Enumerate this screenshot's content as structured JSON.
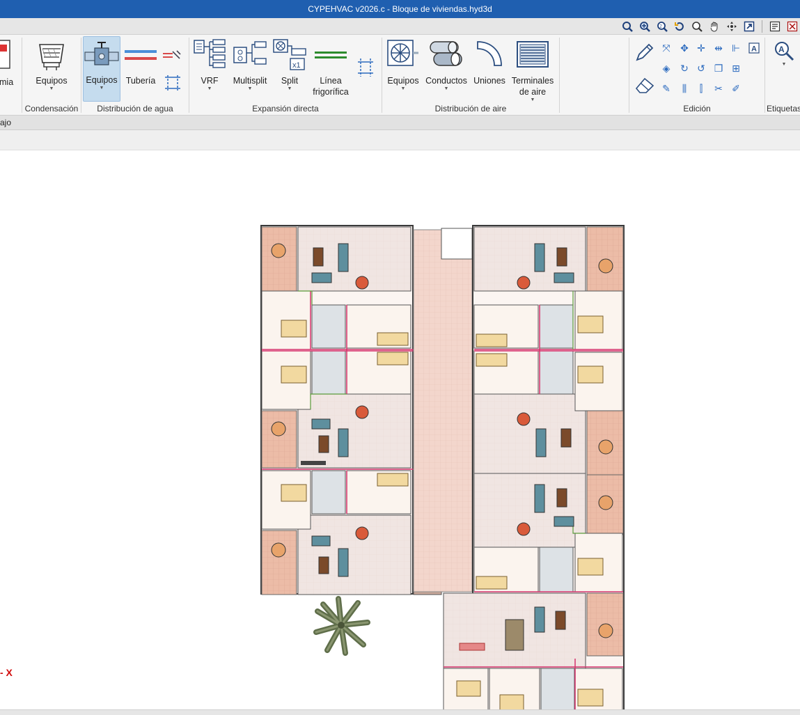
{
  "window": {
    "title": "CYPEHVAC v2026.c - Bloque de viviendas.hyd3d"
  },
  "quick_toolbar": {
    "icons": [
      "zoom-window-icon",
      "zoom-extents-icon",
      "zoom-previous-icon",
      "redraw-icon",
      "zoom-icon",
      "pan-hand-icon",
      "orbit-icon",
      "export-view-icon",
      "dxf-icon",
      "settings-icon"
    ]
  },
  "ribbon": {
    "partial_left_label": "rmia",
    "groups": {
      "condensacion": {
        "label": "Condensación",
        "equipos": "Equipos"
      },
      "distribucion_agua": {
        "label": "Distribución de agua",
        "equipos": "Equipos",
        "tuberia": "Tubería"
      },
      "expansion_directa": {
        "label": "Expansión directa",
        "vrf": "VRF",
        "multisplit": "Multisplit",
        "split": "Split",
        "linea_frigorifica": "Línea\nfrigorífica"
      },
      "distribucion_aire": {
        "label": "Distribución de aire",
        "equipos": "Equipos",
        "conductos": "Conductos",
        "uniones": "Uniones",
        "terminales": "Terminales\nde aire"
      },
      "edicion": {
        "label": "Edición"
      },
      "etiquetas": {
        "label": "Etiquetas"
      }
    },
    "accent": "#1f5fb0",
    "active_bg": "#c5dcee"
  },
  "panel": {
    "partial_tab_label": "ajo"
  },
  "canvas": {
    "axis_label": "- X",
    "plan_colors": {
      "wall": "#3a3a3a",
      "corridor": "#f2d0c6",
      "terrace": "#e9b9a4",
      "heating": "#d6336c",
      "water": "#5a9a3a"
    }
  }
}
